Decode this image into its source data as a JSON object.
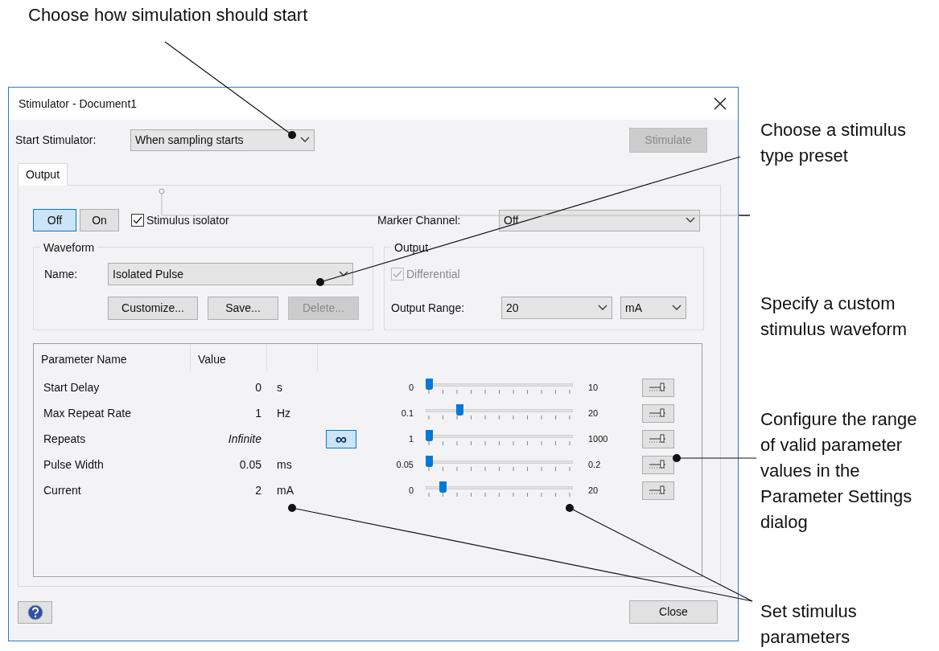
{
  "annotations": [
    {
      "text": "Choose how simulation should start"
    },
    {
      "text": "Choose a stimulus type preset"
    },
    {
      "text": "Specify a custom stimulus waveform"
    },
    {
      "text": "Configure the range of valid parameter values in the Parameter Settings dialog"
    },
    {
      "text": "Set stimulus parameters"
    }
  ],
  "window": {
    "title": "Stimulator - Document1"
  },
  "start_stimulator": {
    "label": "Start Stimulator:",
    "value": "When sampling starts"
  },
  "stimulate_button": {
    "label": "Stimulate",
    "disabled": true
  },
  "tabs": [
    {
      "label": "Output",
      "selected": true
    }
  ],
  "output_toggle": [
    {
      "label": "Off",
      "selected": true
    },
    {
      "label": "On",
      "selected": false
    }
  ],
  "stimulus_isolator": {
    "label": "Stimulus isolator",
    "checked": true
  },
  "marker_channel": {
    "label": "Marker Channel:",
    "value": "Off"
  },
  "waveform": {
    "title": "Waveform",
    "name_label": "Name:",
    "name_value": "Isolated Pulse",
    "buttons": [
      {
        "label": "Customize...",
        "disabled": false
      },
      {
        "label": "Save...",
        "disabled": false
      },
      {
        "label": "Delete...",
        "disabled": true
      }
    ]
  },
  "output": {
    "title": "Output",
    "differential": {
      "label": "Differential",
      "checked": true,
      "disabled": true
    },
    "range_label": "Output Range:",
    "range_value": "20",
    "unit_value": "mA"
  },
  "parameters": {
    "columns": [
      "Parameter Name",
      "Value"
    ],
    "rows": [
      {
        "name": "Start Delay",
        "value": "0",
        "unit": "s",
        "kind": "number",
        "min": "0",
        "max": "10",
        "level": 0
      },
      {
        "name": "Max Repeat Rate",
        "value": "1",
        "unit": "Hz",
        "kind": "number",
        "min": "0.1",
        "max": "20",
        "level": 0.22
      },
      {
        "name": "Repeats",
        "value": "Infinite",
        "kind": "infinite",
        "infinity_button": {
          "label": "∞",
          "selected": true
        },
        "min": "1",
        "max": "1000",
        "level": 0
      },
      {
        "name": "Pulse Width",
        "value": "0.05",
        "unit": "ms",
        "kind": "number",
        "min": "0.05",
        "max": "0.2",
        "level": 0
      },
      {
        "name": "Current",
        "value": "2",
        "unit": "mA",
        "kind": "number",
        "min": "0",
        "max": "20",
        "level": 0.1
      }
    ]
  },
  "close_button": {
    "label": "Close"
  }
}
